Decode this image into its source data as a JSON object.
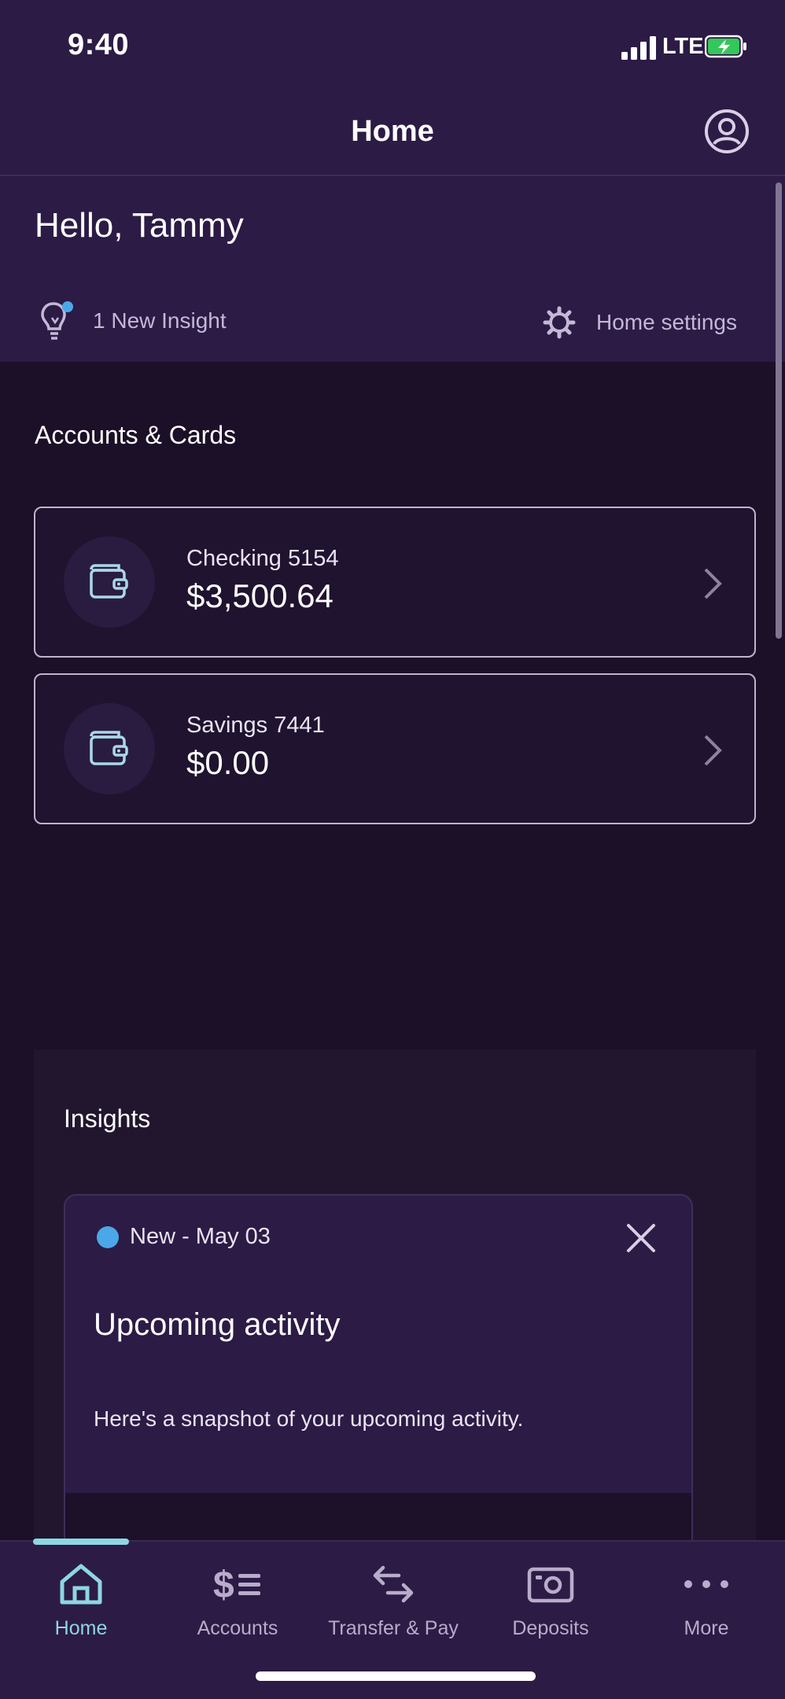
{
  "status_bar": {
    "time": "9:40",
    "network": "LTE"
  },
  "header": {
    "title": "Home",
    "greeting": "Hello, Tammy",
    "insight_link": "1 New Insight",
    "settings_link": "Home settings"
  },
  "accounts": {
    "section_title": "Accounts & Cards",
    "items": [
      {
        "name": "Checking 5154",
        "balance": "$3,500.64"
      },
      {
        "name": "Savings 7441",
        "balance": "$0.00"
      }
    ]
  },
  "insights": {
    "section_title": "Insights",
    "card": {
      "meta": "New - May 03",
      "title": "Upcoming activity",
      "body": "Here's a snapshot of your upcoming activity."
    }
  },
  "tabbar": {
    "items": [
      {
        "label": "Home",
        "icon": "home-icon",
        "active": true
      },
      {
        "label": "Accounts",
        "icon": "dollar-list-icon",
        "active": false
      },
      {
        "label": "Transfer & Pay",
        "icon": "transfer-arrows-icon",
        "active": false
      },
      {
        "label": "Deposits",
        "icon": "camera-check-icon",
        "active": false
      },
      {
        "label": "More",
        "icon": "more-dots-icon",
        "active": false
      }
    ]
  },
  "colors": {
    "header_bg": "#2c1b45",
    "page_bg": "#1b1028",
    "accent": "#8ed6e2",
    "new_dot": "#4aa8e8",
    "battery_fill": "#34c759"
  }
}
